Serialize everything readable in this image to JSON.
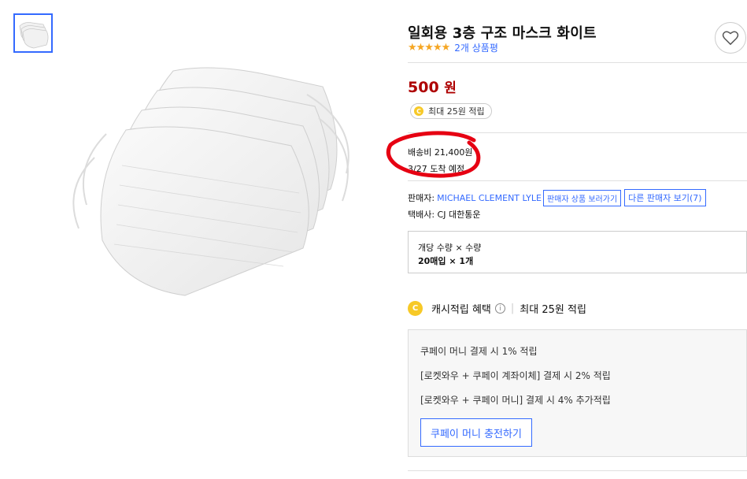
{
  "product": {
    "title": "일회용 3층 구조 마스크 화이트",
    "stars": "★★★★★",
    "review_count": "2개 상품평",
    "price_amount": "500",
    "price_unit": "원",
    "reward_pill": "최대 25원 적립"
  },
  "shipping": {
    "fee": "배송비 21,400원",
    "arrival": "3/27 도착 예정"
  },
  "seller": {
    "label": "판매자:",
    "name": "MICHAEL CLEMENT LYLE",
    "view_products_btn": "판매자 상품 보러가기",
    "other_sellers_btn": "다른 판매자 보기(7)"
  },
  "courier": "택배사: CJ 대한통운",
  "option": {
    "header": "개당 수량 × 수량",
    "value": "20매입 × 1개"
  },
  "cash": {
    "coin_letter": "C",
    "label": "캐시적립 혜택",
    "info": "i",
    "amount": "최대 25원 적립"
  },
  "benefits": {
    "lines": [
      "쿠페이 머니 결제 시 1% 적립",
      "[로켓와우 + 쿠페이 계좌이체] 결제 시 2% 적립",
      "[로켓와우 + 쿠페이 머니] 결제 시 4% 추가적립"
    ],
    "charge_button": "쿠페이 머니 충전하기"
  },
  "icons": {
    "wishlist": "heart-icon",
    "coin": "cash-coin-icon",
    "info": "info-circle-icon"
  },
  "colors": {
    "price": "#ae0000",
    "link": "#346aff",
    "star": "#f5a623",
    "coin": "#f7c927",
    "annotation": "#e60012"
  }
}
